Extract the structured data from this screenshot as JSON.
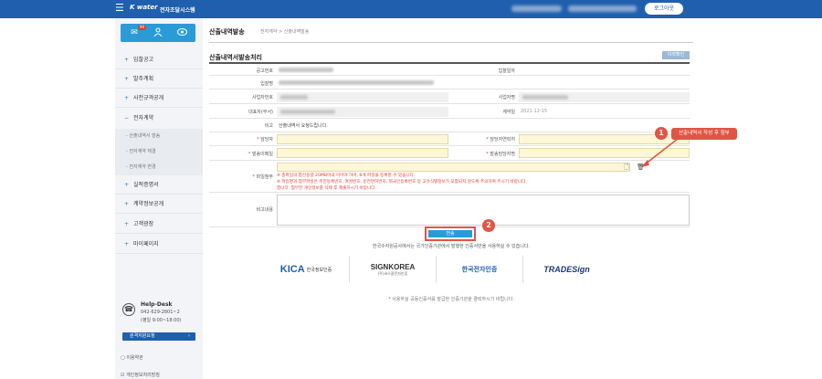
{
  "header": {
    "logo_text": "K water",
    "system_title": "전자조달시스템",
    "logout_label": "로그아웃"
  },
  "sidebar": {
    "mail_badge": "99",
    "menu": [
      {
        "label": "입찰공고"
      },
      {
        "label": "발주계획"
      },
      {
        "label": "사전규격공개"
      },
      {
        "label": "전자계약"
      },
      {
        "label": "실적증명서"
      },
      {
        "label": "계약정보공개"
      },
      {
        "label": "고객광장"
      },
      {
        "label": "마이페이지"
      }
    ],
    "submenu": [
      {
        "label": "산출내역서 발송"
      },
      {
        "label": "전자계약 체결"
      },
      {
        "label": "전자계약 변경"
      }
    ],
    "helpdesk_title": "Help-Desk",
    "helpdesk_phone": "042-629-2801~2",
    "helpdesk_hours": "(평일 9:00~18:00)",
    "remote_button": "원격지원요청",
    "extra_items": [
      {
        "label": "이용약관"
      },
      {
        "label": "개인정보처리방침"
      }
    ]
  },
  "page": {
    "title": "산출내역발송",
    "breadcrumb": "전자계약 > 산출내역발송",
    "section_title": "산출내역서발송처리",
    "print_button": "이력확인"
  },
  "form": {
    "labels": {
      "notice_no": "공고번호",
      "bid_date": "입찰일자",
      "bid_name": "입찰명",
      "company_reg": "사업자번호",
      "company_name": "사업자명",
      "ceo": "대표자(부서)",
      "amount": "계약일",
      "remark": "비고",
      "manager": "담당자",
      "manager_phone": "담당자연락처",
      "email": "발송이메일",
      "email2": "발송담당자명",
      "file": "파일첨부",
      "memo": "비고내용"
    },
    "remark_value": "산출내역서 요청드립니다.",
    "date_value": "2021-12-15",
    "file_notes": [
      "※ 총파일의 합산용량 20MB이내 이어야 하며, 8개 파일을 등록할 수 있습니다.",
      "※ 파일명과 첨부파일은 주민등록번호, 여권번호, 운전면허번호, 외국인등록번호 등 고유식별정보가 포함되지 않도록 주의하여 주시기 바랍니다.",
      "합니다. 첨부전 개인정보를 삭제 후 제출하시기 바랍니다."
    ]
  },
  "annotations": {
    "callout1_num": "1",
    "callout1_text": "산출내역서 작성 후 첨부",
    "callout2_num": "2",
    "send_button": "전송"
  },
  "cert": {
    "message": "한국수자원공사에서는 국가인증기관에서 발행한 인증서만을 사용하실 수 있습니다.",
    "logos": [
      {
        "main": "KICA",
        "sub": "한국정보인증"
      },
      {
        "main": "SIGNKOREA",
        "sub": "(주)코스콤전자인증"
      },
      {
        "main": "한국전자인증",
        "sub": ""
      },
      {
        "main": "TRADESign",
        "sub": ""
      }
    ],
    "bottom_message": "* 사용하실 공동인증서를 발급한 인증기관을 클릭하시기 바랍니다."
  }
}
